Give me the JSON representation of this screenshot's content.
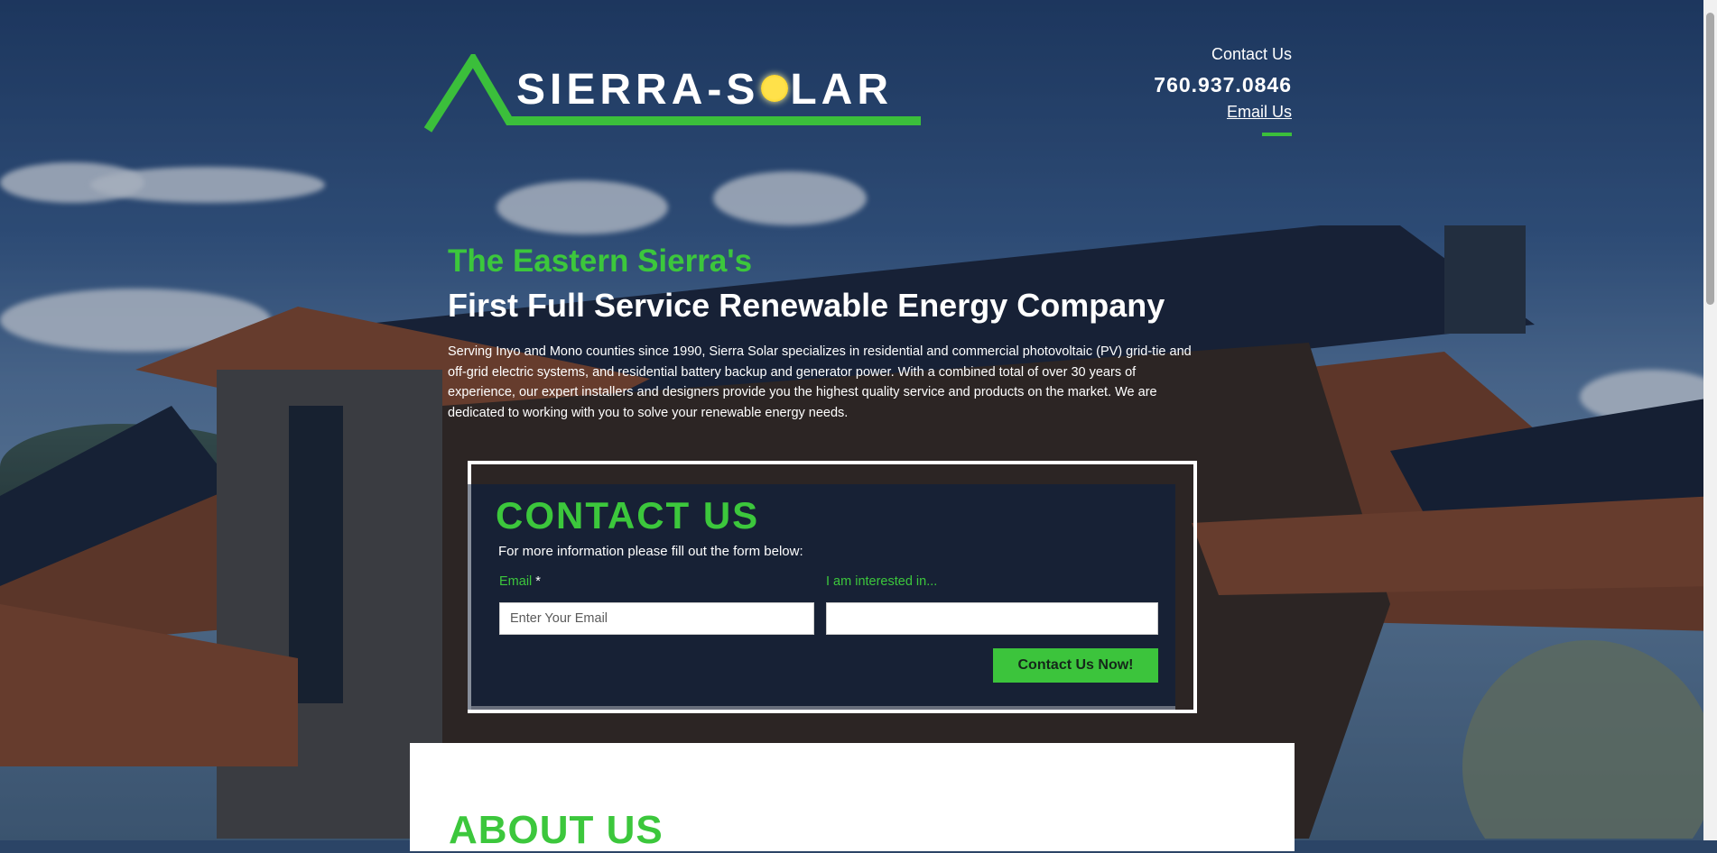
{
  "header": {
    "contact_label": "Contact Us",
    "phone": "760.937.0846",
    "email_link": "Email Us"
  },
  "logo": {
    "text_left": "SIERRA-S",
    "text_right": "LAR"
  },
  "hero": {
    "kicker": "The Eastern Sierra's",
    "title": "First Full Service Renewable Energy Company",
    "body": "Serving Inyo and Mono counties since 1990, Sierra Solar specializes in residential and commercial photovoltaic (PV) grid-tie and off-grid electric systems, and residential battery backup and generator power.  With a combined total of over 30 years of experience, our expert installers and designers provide you the highest quality service and products on the market. We are dedicated to working with you to solve your renewable energy needs."
  },
  "contact_form": {
    "title": "CONTACT US",
    "subtitle": "For more information please fill out the form below:",
    "email_label": "Email",
    "required_mark": "*",
    "email_placeholder": "Enter Your Email",
    "interest_label": "I am interested in...",
    "interest_value": "",
    "submit_label": "Contact Us Now!"
  },
  "about": {
    "title": "ABOUT US"
  },
  "colors": {
    "accent_green": "#3cc73c",
    "overlay_navy": "#12203a"
  }
}
